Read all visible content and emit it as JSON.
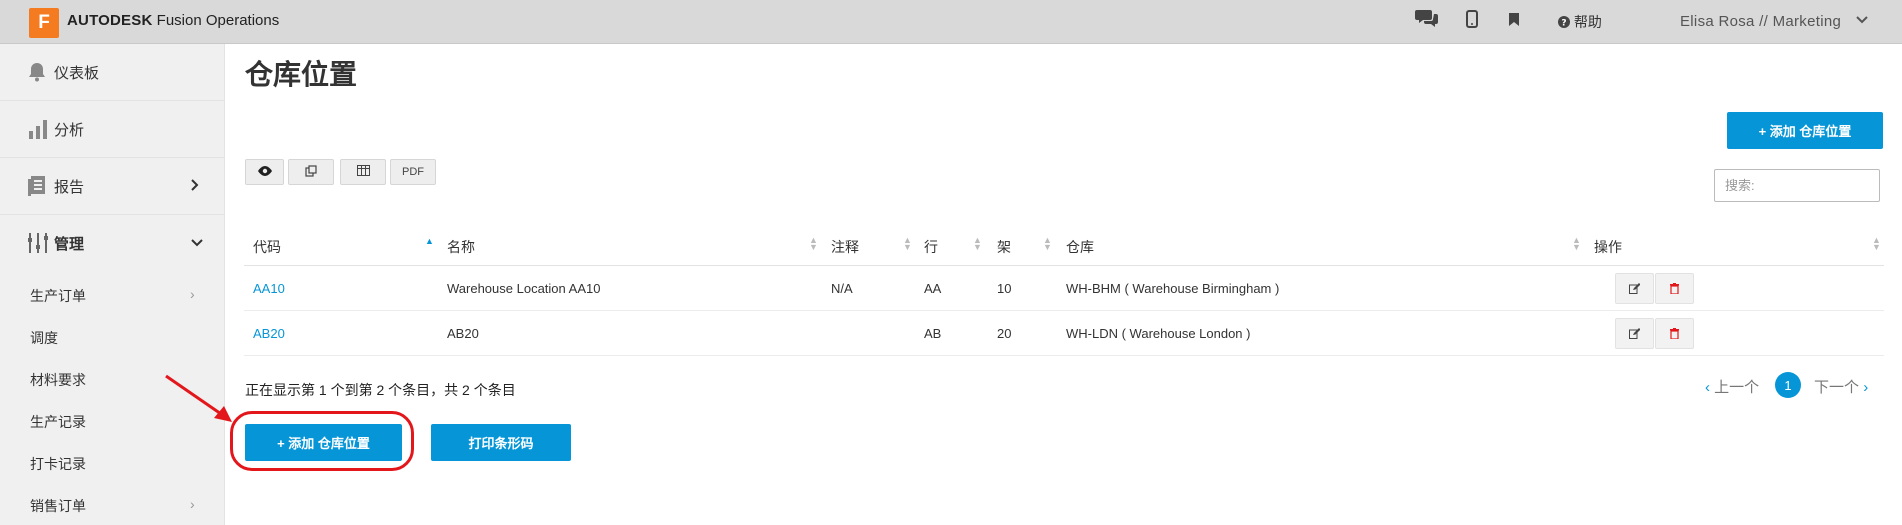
{
  "header": {
    "logo_letter": "F",
    "brand_bold": "AUTODESK",
    "brand_rest": "Fusion Operations",
    "help_label": "帮助",
    "user_label": "Elisa Rosa // Marketing",
    "icons": [
      "chat-icon",
      "mobile-icon",
      "bookmark-icon",
      "help-icon",
      "chevron-down-icon"
    ]
  },
  "sidebar": {
    "main": [
      {
        "label": "仪表板",
        "icon": "bell-icon"
      },
      {
        "label": "分析",
        "icon": "bar-chart-icon"
      },
      {
        "label": "报告",
        "icon": "report-icon"
      },
      {
        "label": "管理",
        "icon": "manage-icon"
      }
    ],
    "sub": [
      {
        "label": "生产订单",
        "has_arrow": true
      },
      {
        "label": "调度",
        "has_arrow": false
      },
      {
        "label": "材料要求",
        "has_arrow": false
      },
      {
        "label": "生产记录",
        "has_arrow": false
      },
      {
        "label": "打卡记录",
        "has_arrow": false
      },
      {
        "label": "销售订单",
        "has_arrow": true
      }
    ]
  },
  "page": {
    "title": "仓库位置",
    "add_button_top": "+ 添加 仓库位置",
    "search_placeholder": "搜索:",
    "toolbar": {
      "pdf_label": "PDF"
    }
  },
  "table": {
    "headers": [
      "代码",
      "名称",
      "注释",
      "行",
      "架",
      "仓库",
      "操作"
    ],
    "rows": [
      {
        "code": "AA10",
        "name": "Warehouse Location AA10",
        "note": "N/A",
        "row": "AA",
        "rack": "10",
        "warehouse": "WH-BHM ( Warehouse Birmingham )"
      },
      {
        "code": "AB20",
        "name": "AB20",
        "note": "",
        "row": "AB",
        "rack": "20",
        "warehouse": "WH-LDN ( Warehouse London )"
      }
    ]
  },
  "footer": {
    "info_text": "正在显示第 1 个到第 2 个条目，共 2 个条目",
    "prev_label": "上一个",
    "page_number": "1",
    "next_label": "下一个",
    "add_button_bottom": "+ 添加 仓库位置",
    "print_barcode_label": "打印条形码"
  },
  "colors": {
    "accent": "#0696d7",
    "logo": "#f47b20",
    "delete": "#e3171b",
    "annotation": "#e3171b"
  }
}
